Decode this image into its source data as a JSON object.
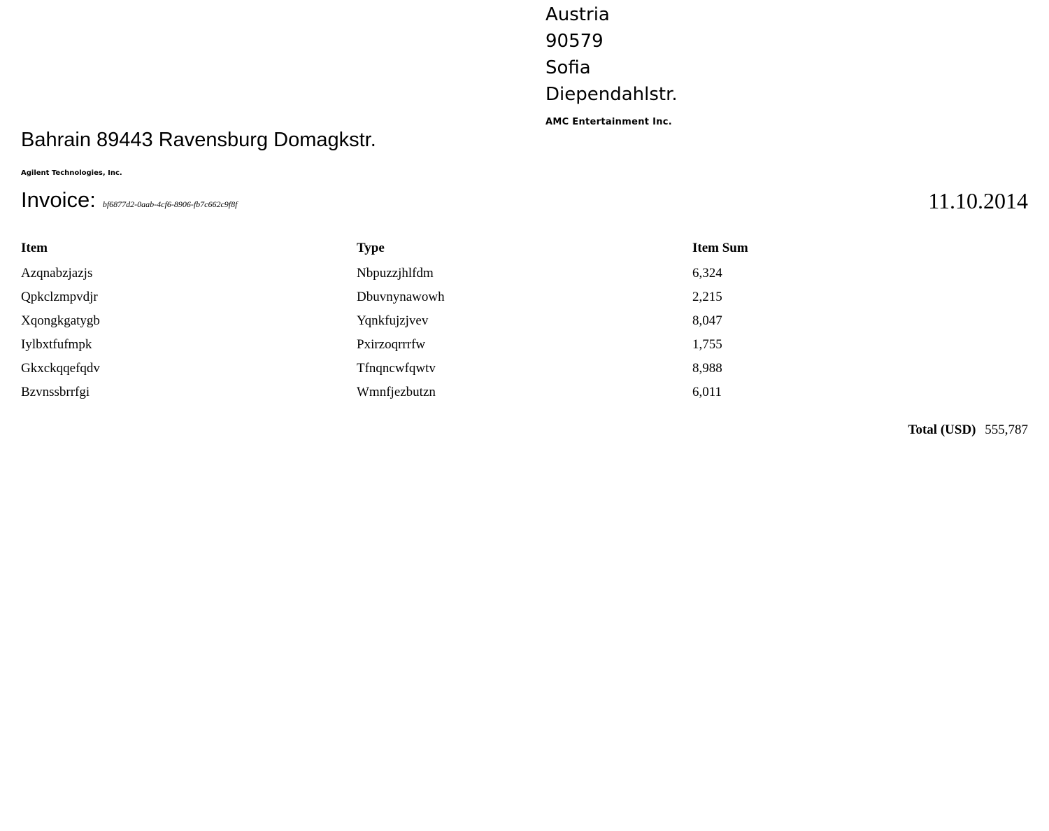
{
  "recipient": {
    "lines": [
      "Austria",
      "90579",
      "Sofia",
      "Diependahlstr."
    ],
    "company": "AMC Entertainment Inc."
  },
  "sender": {
    "address": "Bahrain 89443 Ravensburg Domagkstr.",
    "company": "Agilent Technologies, Inc."
  },
  "invoice": {
    "label": "Invoice:",
    "number": "bf6877d2-0aab-4cf6-8906-fb7c662c9f8f",
    "date": "11.10.2014"
  },
  "table": {
    "headers": [
      "Item",
      "Type",
      "Item Sum"
    ],
    "rows": [
      [
        "Azqnabzjazjs",
        "Nbpuzzjhlfdm",
        "6,324"
      ],
      [
        "Qpkclzmpvdjr",
        "Dbuvnynawowh",
        "2,215"
      ],
      [
        "Xqongkgatygb",
        "Yqnkfujzjvev",
        "8,047"
      ],
      [
        "Iylbxtfufmpk",
        "Pxirzoqrrrfw",
        "1,755"
      ],
      [
        "Gkxckqqefqdv",
        "Tfnqncwfqwtv",
        "8,988"
      ],
      [
        "Bzvnssbrrfgi",
        "Wmnfjezbutzn",
        "6,011"
      ]
    ]
  },
  "total": {
    "label": "Total (USD)",
    "value": "555,787"
  }
}
